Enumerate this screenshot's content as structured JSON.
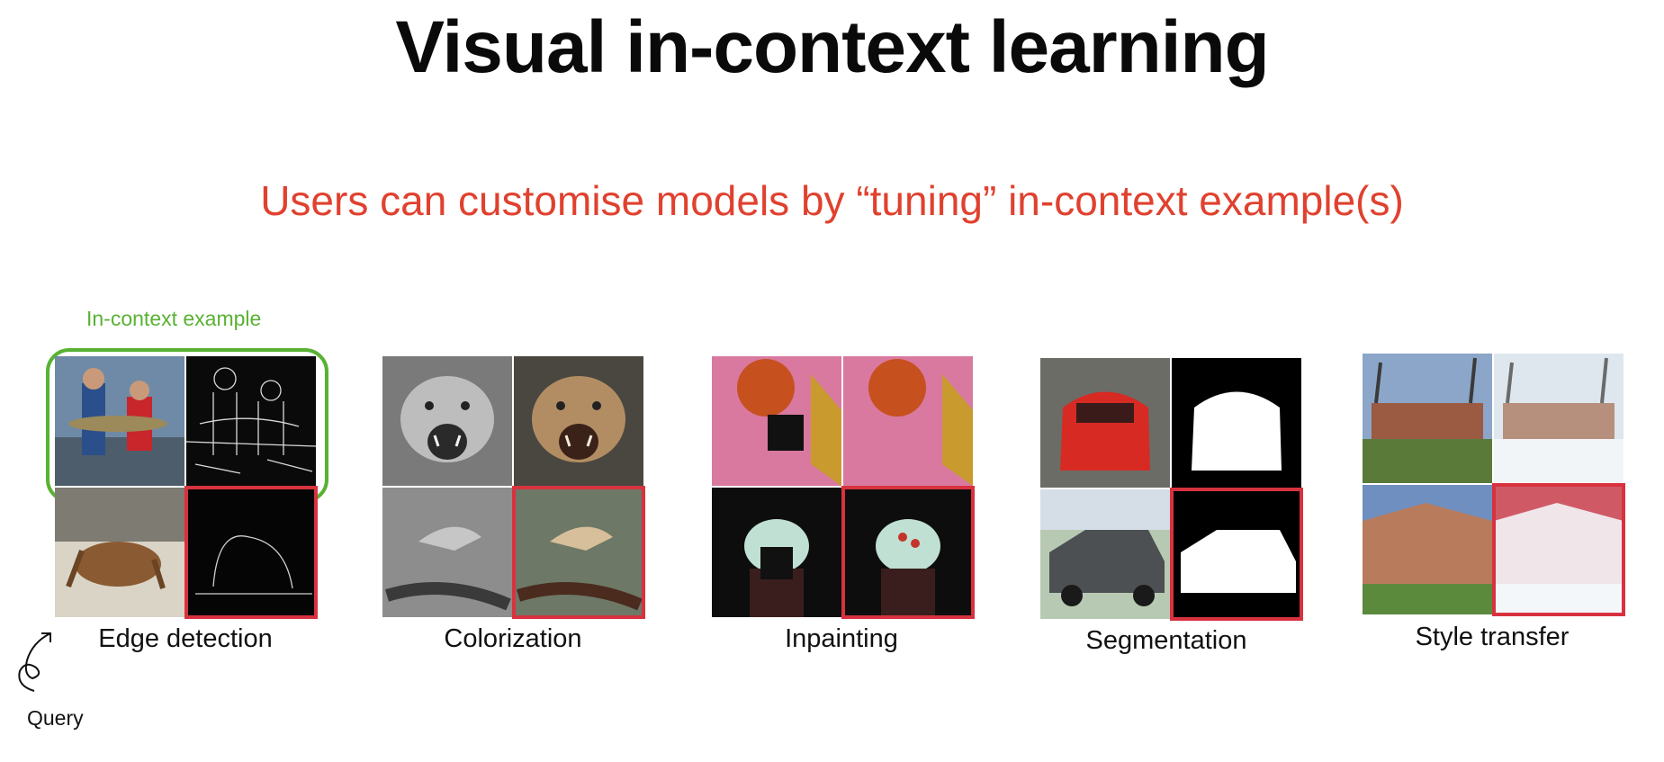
{
  "slide": {
    "title": "Visual in-context learning",
    "subtitle": "Users can customise models by “tuning” in-context example(s)",
    "in_context_label": "In-context example",
    "query_label": "Query"
  },
  "tasks": [
    {
      "name": "Edge detection"
    },
    {
      "name": "Colorization"
    },
    {
      "name": "Inpainting"
    },
    {
      "name": "Segmentation"
    },
    {
      "name": "Style transfer"
    }
  ],
  "colors": {
    "title": "#0a0a0a",
    "subtitle": "#e0412f",
    "in_context": "#58b233",
    "output_highlight": "#d8323f"
  }
}
